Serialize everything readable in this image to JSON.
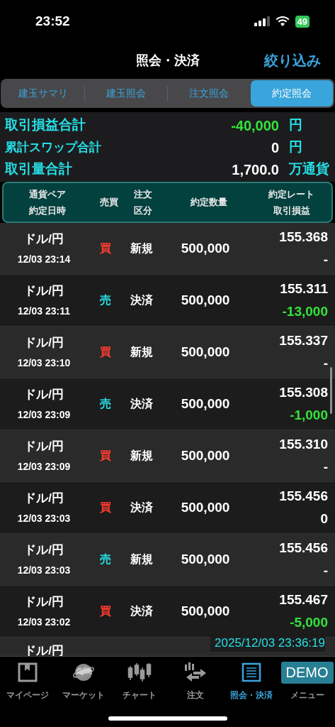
{
  "status_bar": {
    "time": "23:52",
    "battery": "49"
  },
  "header": {
    "title": "照会・決済",
    "filter_button": "絞り込み"
  },
  "tabs": [
    {
      "label": "建玉サマリ",
      "selected": false
    },
    {
      "label": "建玉照会",
      "selected": false
    },
    {
      "label": "注文照会",
      "selected": false
    },
    {
      "label": "約定照会",
      "selected": true
    }
  ],
  "summary": [
    {
      "label": "取引損益合計",
      "value": "-40,000",
      "unit": "円",
      "color": "#33e23a"
    },
    {
      "label": "累計スワップ合計",
      "value": "0",
      "unit": "円",
      "color": "#ffffff"
    },
    {
      "label": "取引量合計",
      "value": "1,700.0",
      "unit": "万通貨",
      "color": "#ffffff"
    }
  ],
  "table": {
    "columns": [
      {
        "lines": [
          "通貨ペア",
          "約定日時"
        ]
      },
      {
        "lines": [
          "売買"
        ]
      },
      {
        "lines": [
          "注文",
          "区分"
        ]
      },
      {
        "lines": [
          "約定数量"
        ]
      },
      {
        "lines": [
          "約定レート",
          "取引損益"
        ]
      }
    ],
    "rows": [
      {
        "pair": "ドル/円",
        "datetime": "12/03 23:14",
        "side": "買",
        "kind": "buy",
        "order_type": "新規",
        "quantity": "500,000",
        "rate": "155.368",
        "pl": "-",
        "color": "#ffffff"
      },
      {
        "pair": "ドル/円",
        "datetime": "12/03 23:11",
        "side": "売",
        "kind": "sell",
        "order_type": "決済",
        "quantity": "500,000",
        "rate": "155.311",
        "pl": "-13,000",
        "color": "#33e23a"
      },
      {
        "pair": "ドル/円",
        "datetime": "12/03 23:10",
        "side": "買",
        "kind": "buy",
        "order_type": "新規",
        "quantity": "500,000",
        "rate": "155.337",
        "pl": "-",
        "color": "#ffffff"
      },
      {
        "pair": "ドル/円",
        "datetime": "12/03 23:09",
        "side": "売",
        "kind": "sell",
        "order_type": "決済",
        "quantity": "500,000",
        "rate": "155.308",
        "pl": "-1,000",
        "color": "#33e23a"
      },
      {
        "pair": "ドル/円",
        "datetime": "12/03 23:09",
        "side": "買",
        "kind": "buy",
        "order_type": "新規",
        "quantity": "500,000",
        "rate": "155.310",
        "pl": "-",
        "color": "#ffffff"
      },
      {
        "pair": "ドル/円",
        "datetime": "12/03 23:03",
        "side": "買",
        "kind": "buy",
        "order_type": "決済",
        "quantity": "500,000",
        "rate": "155.456",
        "pl": "0",
        "color": "#ffffff"
      },
      {
        "pair": "ドル/円",
        "datetime": "12/03 23:03",
        "side": "売",
        "kind": "sell",
        "order_type": "新規",
        "quantity": "500,000",
        "rate": "155.456",
        "pl": "-",
        "color": "#ffffff"
      },
      {
        "pair": "ドル/円",
        "datetime": "12/03 23:02",
        "side": "買",
        "kind": "buy",
        "order_type": "決済",
        "quantity": "500,000",
        "rate": "155.467",
        "pl": "-5,000",
        "color": "#33e23a"
      },
      {
        "pair": "ドル/円"
      }
    ]
  },
  "timestamp": "2025/12/03 23:36:19",
  "nav": [
    {
      "label": "マイページ",
      "selected": false
    },
    {
      "label": "マーケット",
      "selected": false
    },
    {
      "label": "チャート",
      "selected": false
    },
    {
      "label": "注文",
      "selected": false
    },
    {
      "label": "照会・決済",
      "selected": true
    },
    {
      "label": "メニュー",
      "badge": "DEMO",
      "selected": false
    }
  ]
}
